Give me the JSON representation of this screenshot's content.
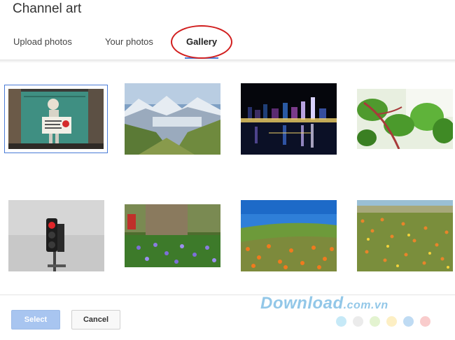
{
  "dialog": {
    "title": "Channel art"
  },
  "tabs": [
    {
      "label": "Upload photos"
    },
    {
      "label": "Your photos"
    },
    {
      "label": "Gallery"
    }
  ],
  "gallery": {
    "images": [
      {
        "name": "graffiti-child"
      },
      {
        "name": "mountain-valley"
      },
      {
        "name": "city-night-skyline"
      },
      {
        "name": "green-leaves"
      },
      {
        "name": "traffic-light"
      },
      {
        "name": "woodland-flowers"
      },
      {
        "name": "poppy-hill"
      },
      {
        "name": "wildflower-field"
      }
    ]
  },
  "footer": {
    "select_label": "Select",
    "cancel_label": "Cancel"
  },
  "watermark": {
    "main": "Download",
    "suffix": ".com.vn"
  },
  "colors": {
    "accent": "#4a7cd6",
    "annotation": "#d11e1e",
    "select_button": "#a8c5f0",
    "dots": [
      "#8dd3f0",
      "#d8d8d8",
      "#c7e8a2",
      "#fbe08a",
      "#7fb8e8",
      "#f39a9a"
    ]
  }
}
